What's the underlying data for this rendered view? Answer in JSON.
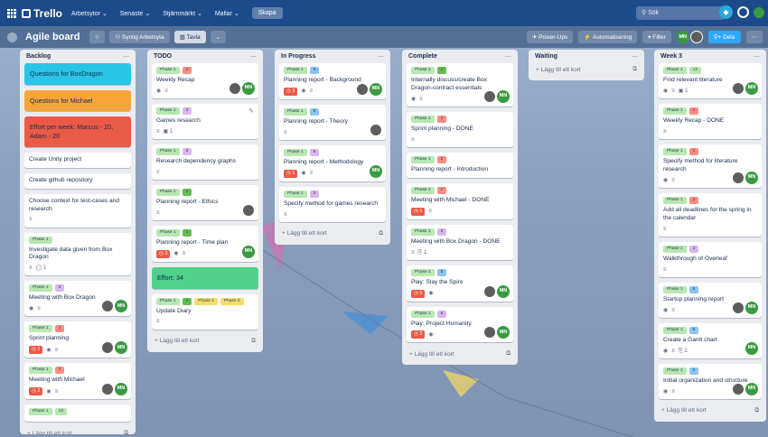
{
  "topnav": {
    "app_name": "Trello",
    "menus": [
      "Arbetsytor ⌄",
      "Senaste ⌄",
      "Stjärnmärkt ⌄",
      "Mallar ⌄"
    ],
    "create_label": "Skapa",
    "search_placeholder": "Sök"
  },
  "boardbar": {
    "title": "Agile board",
    "visibility": "Synlig Arbetsyta",
    "view": "Tavla",
    "powerups": "Power-Ups",
    "automation": "Automatisering",
    "filter": "Filter",
    "share": "Dela"
  },
  "add_card_label": "+ Lägg till ett kort",
  "colors": {
    "phase": "#b8e7b2",
    "green": "#61bd4f",
    "red": "#ff8c82",
    "blue": "#8bc4ef",
    "purple": "#d8b6ee",
    "yellow": "#f5dd6d",
    "cyan": "#29c5e6",
    "orange": "#f7a53b",
    "redcard": "#eb5a46",
    "greencard": "#4fd18b"
  },
  "lists": [
    {
      "title": "Backlog",
      "cards": [
        {
          "title": "Questions for BoxDragon",
          "bg": "cyan"
        },
        {
          "title": "Questions for Michael",
          "bg": "orange"
        },
        {
          "title": "Effort per week: Marcus - 20, Adam - 20",
          "bg": "redcard"
        },
        {
          "title": "Create Unity project"
        },
        {
          "title": "Create github repository"
        },
        {
          "title": "Choose context for test-cases and research",
          "badges": [
            "≡"
          ]
        },
        {
          "title": "Investigate data given from Box Dragon",
          "labels": [
            [
              "Phase 1",
              "phase"
            ]
          ],
          "badges": [
            "≡",
            "◯ 1"
          ]
        },
        {
          "title": "Meeting with Box Dragon",
          "labels": [
            [
              "Phase 1",
              "phase"
            ],
            [
              "3",
              "purple"
            ]
          ],
          "badges": [
            "◉",
            "≡"
          ],
          "members": true
        },
        {
          "title": "Sprint planning",
          "labels": [
            [
              "Phase 1",
              "phase"
            ],
            [
              "2",
              "red"
            ]
          ],
          "due": "◷ 2",
          "badges": [
            "◉",
            "≡"
          ],
          "members": true
        },
        {
          "title": "Meeting with Michael",
          "labels": [
            [
              "Phase 1",
              "phase"
            ],
            [
              "2",
              "red"
            ]
          ],
          "due": "◷ 2",
          "badges": [
            "◉",
            "≡"
          ],
          "members": true
        },
        {
          "title": "",
          "labels": [
            [
              "Phase 1",
              "phase"
            ],
            [
              "13",
              "phase"
            ]
          ]
        }
      ]
    },
    {
      "title": "TODO",
      "cards": [
        {
          "title": "Weekly Recap",
          "labels": [
            [
              "Phase 1",
              "phase"
            ],
            [
              "2",
              "red"
            ]
          ],
          "badges": [
            "◉",
            "≡"
          ],
          "members": true
        },
        {
          "title": "Games research",
          "labels": [
            [
              "Phase 1",
              "phase"
            ],
            [
              "3",
              "purple"
            ]
          ],
          "badges": [
            "≡",
            "▣ 1"
          ],
          "pencil": true
        },
        {
          "title": "Research dependency graphs",
          "labels": [
            [
              "Phase 1",
              "phase"
            ],
            [
              "3",
              "purple"
            ]
          ],
          "badges": [
            "≡"
          ]
        },
        {
          "title": "Planning report - Ethics",
          "labels": [
            [
              "Phase 1",
              "phase"
            ],
            [
              "1",
              "green"
            ]
          ],
          "badges": [
            "≡"
          ],
          "members": "ph"
        },
        {
          "title": "Planning report - Time plan",
          "labels": [
            [
              "Phase 1",
              "phase"
            ],
            [
              "1",
              "green"
            ]
          ],
          "due": "◷ 3",
          "badges": [
            "◉",
            "≡"
          ],
          "members": "mn"
        },
        {
          "title": "Effort: 34",
          "bg": "greencard"
        },
        {
          "title": "Update Diary",
          "labels": [
            [
              "Phase 1",
              "phase"
            ],
            [
              "1",
              "green"
            ],
            [
              "Phase 2",
              "yellow"
            ],
            [
              "Phase 2",
              "yellow"
            ]
          ],
          "badges": [
            "≡"
          ]
        }
      ]
    },
    {
      "title": "In Progress",
      "cards": [
        {
          "title": "Planning report - Background",
          "labels": [
            [
              "Phase 1",
              "phase"
            ],
            [
              "5",
              "blue"
            ]
          ],
          "due": "◷ 3",
          "badges": [
            "◉",
            "≡"
          ],
          "members": true
        },
        {
          "title": "Planning report - Theory",
          "labels": [
            [
              "Phase 1",
              "phase"
            ],
            [
              "5",
              "blue"
            ]
          ],
          "badges": [
            "≡"
          ],
          "members": "ph"
        },
        {
          "title": "Planning report - Methodology",
          "labels": [
            [
              "Phase 1",
              "phase"
            ],
            [
              "8",
              "purple"
            ]
          ],
          "due": "◷ 1",
          "badges": [
            "◉",
            "≡"
          ],
          "members": "mn"
        },
        {
          "title": "Specify method for games research",
          "labels": [
            [
              "Phase 1",
              "phase"
            ],
            [
              "3",
              "purple"
            ]
          ],
          "badges": [
            "≡"
          ]
        }
      ]
    },
    {
      "title": "Complete",
      "cards": [
        {
          "title": "Internally discuss/create Box Dragon-contract essentials",
          "labels": [
            [
              "Phase 1",
              "phase"
            ],
            [
              "1",
              "green"
            ]
          ],
          "badges": [
            "◉",
            "≡"
          ],
          "members": true
        },
        {
          "title": "Sprint planning - DONE",
          "labels": [
            [
              "Phase 1",
              "phase"
            ],
            [
              "2",
              "red"
            ]
          ],
          "badges": [
            "≡"
          ]
        },
        {
          "title": "Planning report - Introduction",
          "labels": [
            [
              "Phase 1",
              "phase"
            ],
            [
              "2",
              "red"
            ]
          ]
        },
        {
          "title": "Meeting with Michael - DONE",
          "labels": [
            [
              "Phase 1",
              "phase"
            ],
            [
              "2",
              "red"
            ]
          ],
          "due": "◷ 1",
          "badges": [
            "≡"
          ]
        },
        {
          "title": "Meeting with Box Dragon - DONE",
          "labels": [
            [
              "Phase 1",
              "phase"
            ],
            [
              "3",
              "purple"
            ]
          ],
          "badges": [
            "≡",
            "⎘ 1"
          ]
        },
        {
          "title": "Play: Slay the Spire",
          "labels": [
            [
              "Phase 1",
              "phase"
            ],
            [
              "5",
              "blue"
            ]
          ],
          "due": "◷ 5",
          "badges": [
            "◉"
          ],
          "members": true
        },
        {
          "title": "Play: Project Humanity",
          "labels": [
            [
              "Phase 1",
              "phase"
            ],
            [
              "8",
              "purple"
            ]
          ],
          "due": "◷ 3",
          "badges": [
            "◉"
          ],
          "members": true
        }
      ]
    },
    {
      "title": "Waiting",
      "cards": []
    },
    {
      "title": "Week 3",
      "cards": [
        {
          "title": "Find relevant literature",
          "labels": [
            [
              "Phase 1",
              "phase"
            ],
            [
              "13",
              "phase"
            ]
          ],
          "badges": [
            "◉",
            "≡",
            "▣ 1"
          ],
          "members": true
        },
        {
          "title": "Weekly Recap - DONE",
          "labels": [
            [
              "Phase 1",
              "phase"
            ],
            [
              "2",
              "red"
            ]
          ],
          "badges": [
            "≡"
          ]
        },
        {
          "title": "Specify method for literature research",
          "labels": [
            [
              "Phase 1",
              "phase"
            ],
            [
              "2",
              "red"
            ]
          ],
          "badges": [
            "◉",
            "≡"
          ],
          "members": true
        },
        {
          "title": "Add all deadlines for the spring in the calendar",
          "labels": [
            [
              "Phase 1",
              "phase"
            ],
            [
              "2",
              "red"
            ]
          ],
          "badges": [
            "≡"
          ]
        },
        {
          "title": "Walkthrough of Overleaf",
          "labels": [
            [
              "Phase 1",
              "phase"
            ],
            [
              "3",
              "purple"
            ]
          ],
          "badges": [
            "≡"
          ]
        },
        {
          "title": "Startup planning report",
          "labels": [
            [
              "Phase 1",
              "phase"
            ],
            [
              "5",
              "blue"
            ]
          ],
          "badges": [
            "◉",
            "≡"
          ],
          "members": true
        },
        {
          "title": "Create a Gantt chart",
          "labels": [
            [
              "Phase 1",
              "phase"
            ],
            [
              "5",
              "blue"
            ]
          ],
          "badges": [
            "◉",
            "≡",
            "⎘ 1"
          ],
          "members": "mn"
        },
        {
          "title": "Initial organization and structure",
          "labels": [
            [
              "Phase 1",
              "phase"
            ],
            [
              "5",
              "blue"
            ]
          ],
          "badges": [
            "◉",
            "≡"
          ],
          "members": true
        }
      ]
    }
  ]
}
